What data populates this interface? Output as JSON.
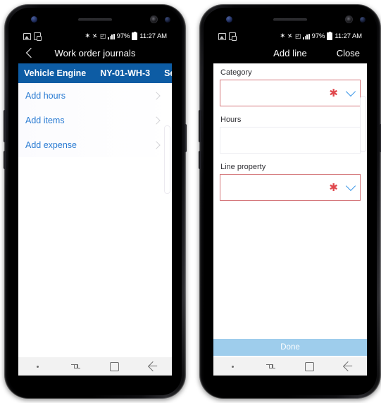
{
  "status_bar": {
    "icons_left": [
      "image-icon",
      "document-icon"
    ],
    "bluetooth": "✶",
    "mute": "✕",
    "wifi": "◰",
    "battery_percent": "97%",
    "time": "11:27 AM"
  },
  "phones": [
    {
      "name": "work-order-journals",
      "app_bar": {
        "back": "‹",
        "title": "Work order journals"
      },
      "context_band": [
        "Vehicle Engine",
        "NY-01-WH-3",
        "Service"
      ],
      "list": [
        {
          "label": "Add hours"
        },
        {
          "label": "Add items"
        },
        {
          "label": "Add expense"
        }
      ]
    },
    {
      "name": "add-line",
      "app_bar": {
        "title": "Add line",
        "close": "Close"
      },
      "fields": [
        {
          "label": "Category",
          "value": "",
          "required": true,
          "type": "dropdown"
        },
        {
          "label": "Hours",
          "value": "",
          "required": false,
          "type": "text"
        },
        {
          "label": "Line property",
          "value": "",
          "required": true,
          "type": "dropdown"
        }
      ],
      "done_label": "Done"
    }
  ],
  "nav_bar": {
    "items": [
      "dot",
      "recents-icon",
      "home-icon",
      "back-icon"
    ]
  },
  "colors": {
    "band_blue": "#0d5ca4",
    "link_blue": "#2b7cd3",
    "required_red": "#d4767a",
    "asterisk_red": "#e0484d",
    "chevron_blue": "#3c97e8",
    "done_blue": "#9ecdec"
  }
}
